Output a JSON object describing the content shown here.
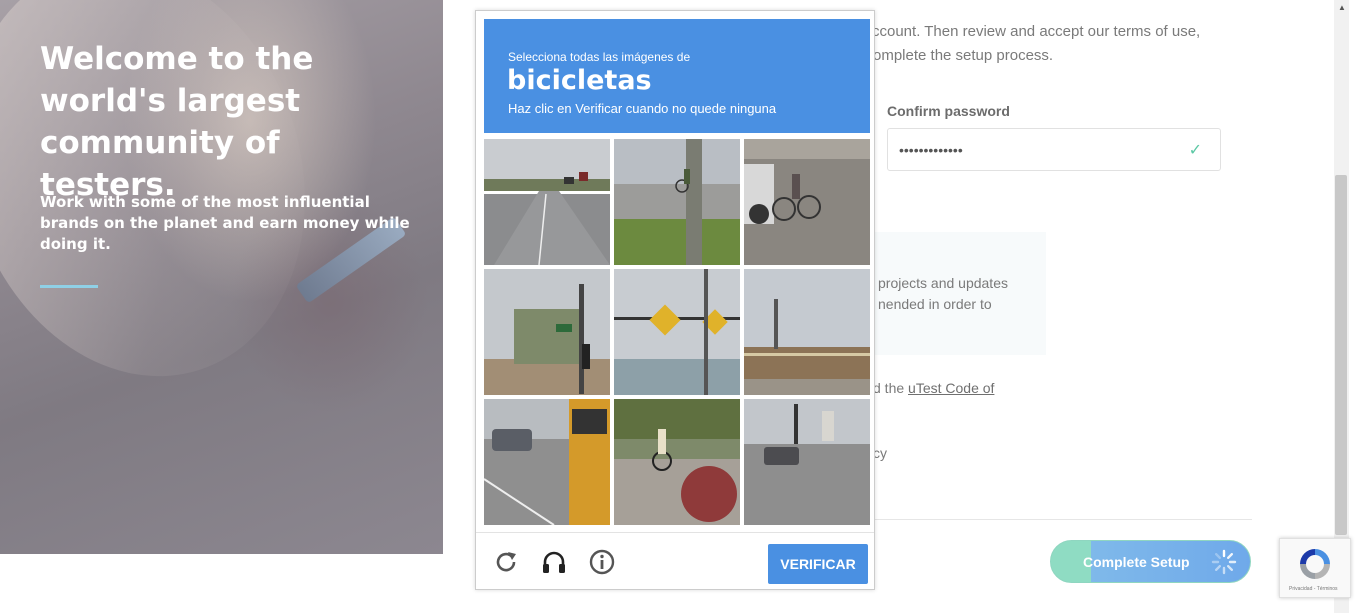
{
  "hero": {
    "title": "Welcome to the world's largest community of testers.",
    "subtitle": "Work with some of the most influential brands on the planet and earn money while doing it."
  },
  "form": {
    "intro_line1": "ccount. Then review and accept our terms of use,",
    "intro_line2": "omplete the setup process.",
    "confirm_label": "Confirm password",
    "confirm_value": "•••••••••••••",
    "info_line1": "projects and updates",
    "info_line2": "nended in order to",
    "code_prefix": "d the ",
    "code_link": "uTest Code of",
    "policy_fragment": "cy",
    "complete_button": "Complete Setup"
  },
  "captcha": {
    "select_text": "Selecciona todas las imágenes de",
    "target_word": "bicicletas",
    "instruction": "Haz clic en Verificar cuando no quede ninguna",
    "verify_button": "VERIFICAR"
  },
  "badge": {
    "terms": "Privacidad - Términos"
  },
  "colors": {
    "captcha_blue": "#4a90e2",
    "accent_green": "#5bc8a4",
    "hero_line": "#8fd0e6"
  }
}
